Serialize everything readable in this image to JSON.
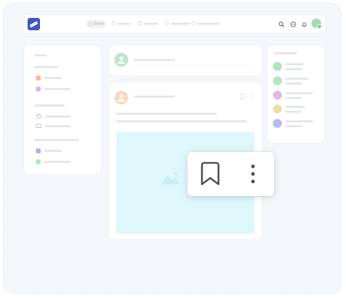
{
  "colors": {
    "brand": "#3d55c8",
    "background": "#f3f7fb",
    "placeholder_bar": "#e3e6ea",
    "post_image": "#def7fb",
    "icon_dark": "#4a4d52"
  },
  "topbar": {
    "logo_icon": "brand-logo",
    "search_label": "Search",
    "icons": [
      "search-icon",
      "chat-icon",
      "bell-icon",
      "avatar"
    ]
  },
  "left_panel": {
    "section_1_icons": [
      "orange-square",
      "purple-square"
    ],
    "section_2_icons": [
      "user-icon",
      "id-card-icon"
    ],
    "section_3_icons": [
      "indigo-square",
      "green-square"
    ]
  },
  "right_panel": {
    "user_avatar_colors": [
      "#b5e2bf",
      "#b6e6c3",
      "#e2b8e8",
      "#ecdfa6",
      "#b5bdee"
    ]
  },
  "popup": {
    "icons": [
      "bookmark-icon",
      "more-vertical-icon"
    ]
  }
}
